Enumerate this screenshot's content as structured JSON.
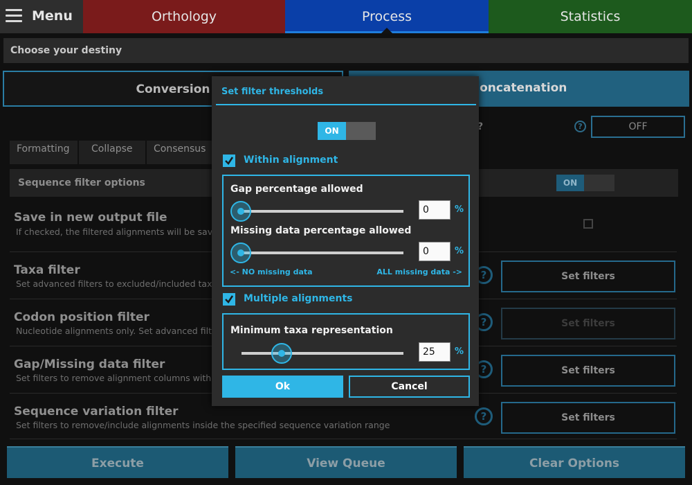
{
  "nav": {
    "menu_label": "Menu",
    "tabs": [
      {
        "label": "Orthology"
      },
      {
        "label": "Process"
      },
      {
        "label": "Statistics"
      }
    ]
  },
  "breadcrumb": "Choose your destiny",
  "modes": {
    "conversion": "Conversion",
    "concatenation": "Concatenation"
  },
  "faint_question": "?",
  "off_label": "OFF",
  "subtabs": [
    "Formatting",
    "Collapse",
    "Consensus"
  ],
  "sequence_filter": {
    "label": "Sequence filter options",
    "toggle": "ON"
  },
  "rows": [
    {
      "title": "Save in new output file",
      "desc": "If checked, the filtered alignments will be saved in"
    },
    {
      "title": "Taxa filter",
      "desc": "Set advanced filters to excluded/included taxa",
      "button": "Set filters"
    },
    {
      "title": "Codon position filter",
      "desc": "Nucleotide alignments only. Set advanced filters to",
      "button": "Set filters"
    },
    {
      "title": "Gap/Missing data filter",
      "desc": "Set filters to remove alignment columns with exce",
      "button": "Set filters"
    },
    {
      "title": "Sequence variation filter",
      "desc": "Set filters to remove/include alignments inside the specified sequence variation range",
      "button": "Set filters"
    }
  ],
  "bottom": {
    "execute": "Execute",
    "view_queue": "View Queue",
    "clear": "Clear Options"
  },
  "dialog": {
    "title": "Set filter thresholds",
    "toggle": "ON",
    "within": {
      "label": "Within alignment",
      "checked": true,
      "gap_label": "Gap percentage allowed",
      "gap_value": "0",
      "missing_label": "Missing data percentage allowed",
      "missing_value": "0",
      "unit": "%",
      "hint_left": "<- NO missing data",
      "hint_right": "ALL missing data ->"
    },
    "multiple": {
      "label": "Multiple alignments",
      "checked": true,
      "min_taxa_label": "Minimum taxa representation",
      "min_taxa_value": "25",
      "unit": "%"
    },
    "ok": "Ok",
    "cancel": "Cancel"
  },
  "colors": {
    "accent": "#2fb6e6",
    "orthology": "#7a1b1b",
    "process": "#0a3fa8",
    "statistics": "#1d5a1d"
  }
}
